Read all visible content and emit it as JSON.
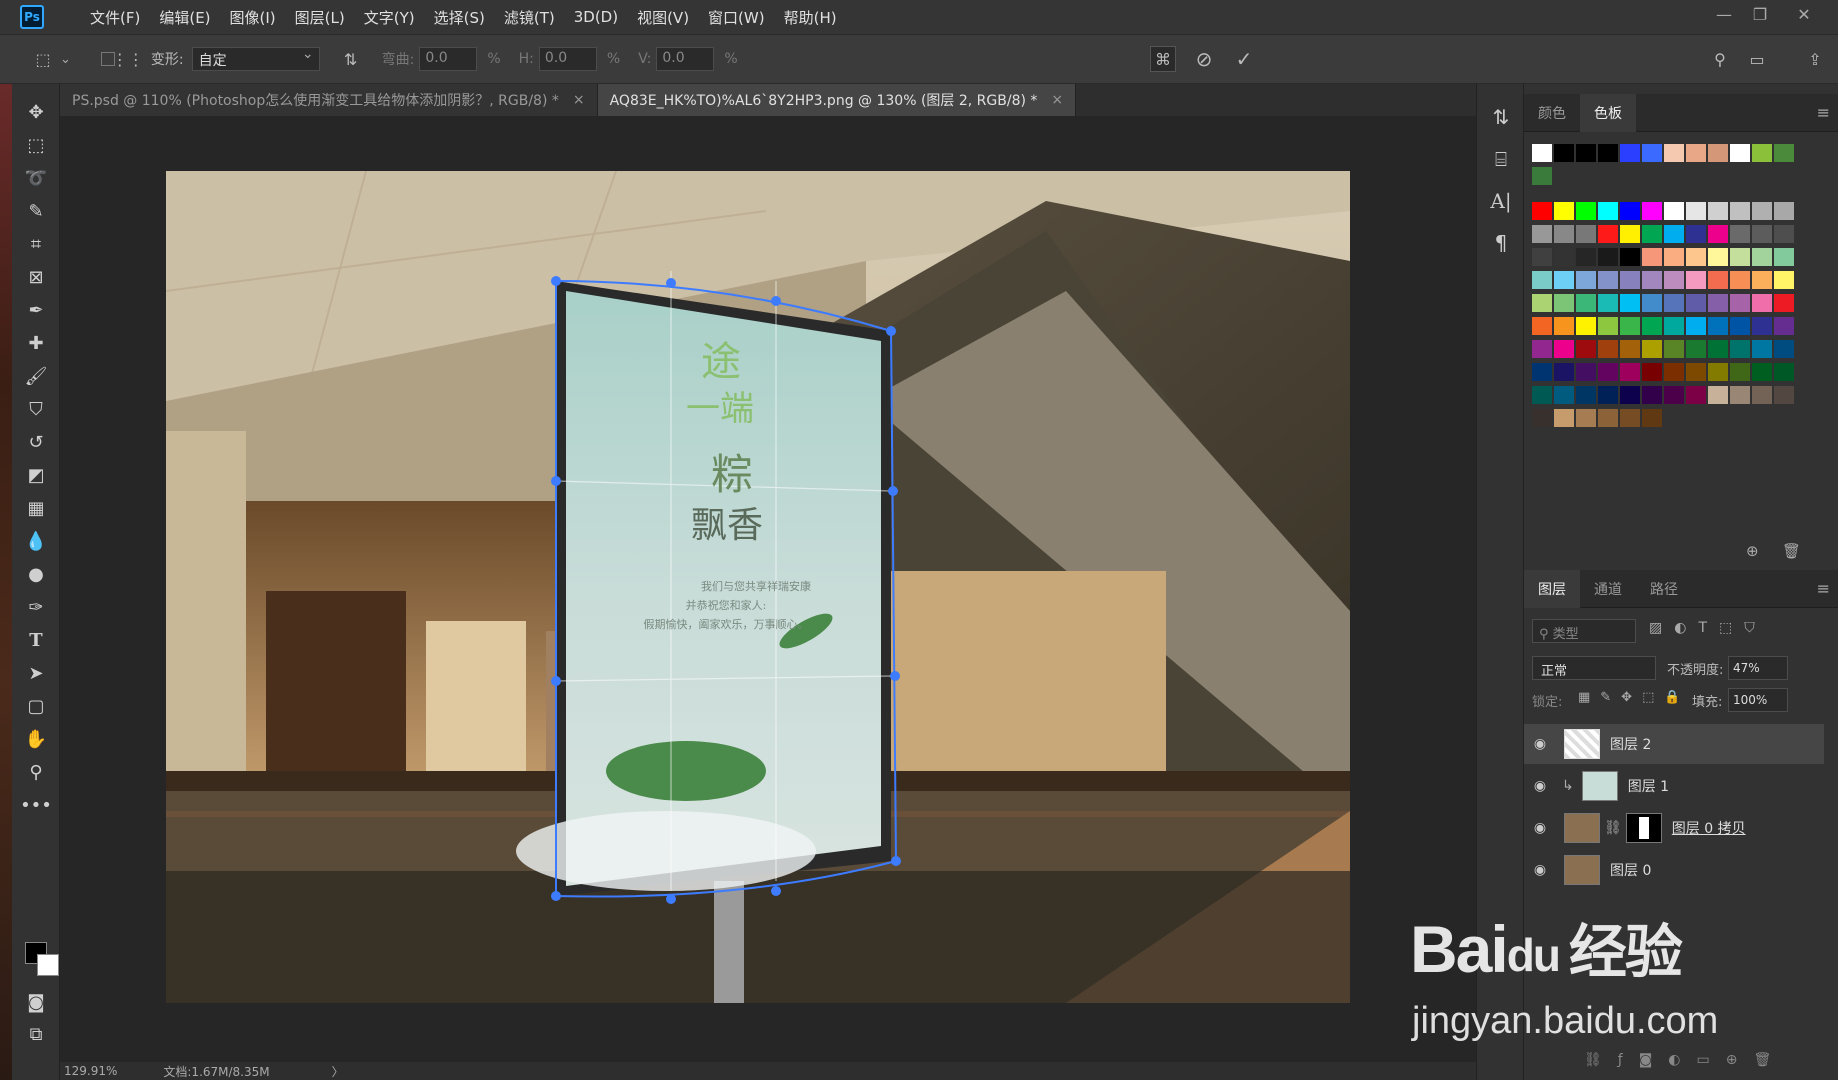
{
  "app": {
    "logo": "Ps"
  },
  "menu": [
    "文件(F)",
    "编辑(E)",
    "图像(I)",
    "图层(L)",
    "文字(Y)",
    "选择(S)",
    "滤镜(T)",
    "3D(D)",
    "视图(V)",
    "窗口(W)",
    "帮助(H)"
  ],
  "window_controls": {
    "minimize": "—",
    "restore": "❐",
    "close": "✕"
  },
  "options": {
    "transform_label": "变形:",
    "transform_value": "自定",
    "bend_label": "弯曲:",
    "bend_value": "0.0",
    "h_label": "H:",
    "h_value": "0.0",
    "v_label": "V:",
    "v_value": "0.0",
    "percent": "%"
  },
  "tabs": [
    {
      "label": "PS.psd @ 110% (Photoshop怎么使用渐变工具给物体添加阴影？, RGB/8) *",
      "close": "×"
    },
    {
      "label": "AQ83E_HK%TO)%AL6`8Y2HP3.png @ 130% (图层 2, RGB/8) *",
      "close": "×"
    }
  ],
  "poster": {
    "title1": "途",
    "title2": "一端",
    "title3": "粽",
    "title4": "飘香",
    "line1": "我们与您共享祥瑞安康",
    "line2": "并恭祝您和家人:",
    "line3": "假期愉快，阖家欢乐，万事顺心。"
  },
  "status": {
    "zoom": "129.91%",
    "doc": "文档:1.67M/8.35M",
    "arrow": "〉"
  },
  "color_panel": {
    "tab_color": "颜色",
    "tab_swatches": "色板"
  },
  "swatch_colors": {
    "recent": [
      "#ffffff",
      "#000000",
      "#000000",
      "#000000",
      "#2a3fff",
      "#3a6aff",
      "#f5c8b0",
      "#e8a888",
      "#d49878",
      "#ffffff",
      "#8ac03a",
      "#4a8a3a",
      "#3a7a3a"
    ],
    "grid": [
      "#ff0000",
      "#ffff00",
      "#00ff00",
      "#00ffff",
      "#0000ff",
      "#ff00ff",
      "#ffffff",
      "#e6e6e6",
      "#d0d0d0",
      "#c0c0c0",
      "#b0b0b0",
      "#a8a8a8",
      "#989898",
      "#888888",
      "#787878",
      "#ff1a1a",
      "#ffef00",
      "#00a651",
      "#00aeef",
      "#2e3192",
      "#ec008c",
      "#6a6a6a",
      "#5c5c5c",
      "#4e4e4e",
      "#404040",
      "#333333",
      "#262626",
      "#1a1a1a",
      "#000000",
      "#f7977a",
      "#fbad82",
      "#fdc68c",
      "#fff799",
      "#c4df9b",
      "#a3d39c",
      "#82ca9c",
      "#7accc8",
      "#6dcff6",
      "#7da7d9",
      "#8393ca",
      "#8781bd",
      "#a187be",
      "#bc8cbf",
      "#f49ac1",
      "#f26c4f",
      "#f68e55",
      "#fbaf5a",
      "#fff467",
      "#acd372",
      "#7cc576",
      "#3bb878",
      "#1abbb4",
      "#00bff3",
      "#438ccb",
      "#5574b9",
      "#605ca8",
      "#855fa8",
      "#a763a8",
      "#f06ea9",
      "#ed1c24",
      "#f26522",
      "#f7941d",
      "#fff200",
      "#8dc63f",
      "#39b54a",
      "#00a651",
      "#00a99d",
      "#00aeef",
      "#0072bc",
      "#0054a6",
      "#2e3192",
      "#662d91",
      "#92278f",
      "#ec008c",
      "#9e0b0f",
      "#a0410d",
      "#a36209",
      "#aba000",
      "#598527",
      "#1a7b30",
      "#007236",
      "#00746b",
      "#0076a3",
      "#004b80",
      "#003471",
      "#1b1464",
      "#440e62",
      "#630460",
      "#9e005d",
      "#790000",
      "#7b2e00",
      "#7d4900",
      "#827b00",
      "#406618",
      "#005e20",
      "#005826",
      "#005952",
      "#005b7f",
      "#003663",
      "#002157",
      "#0d004c",
      "#32004b",
      "#4b0049",
      "#7b0046",
      "#c7b299",
      "#998675",
      "#736357",
      "#534741",
      "#37302d",
      "#c69c6d",
      "#a67c52",
      "#8c6239",
      "#754c24",
      "#603913"
    ]
  },
  "layers_panel": {
    "tabs": [
      "图层",
      "通道",
      "路径"
    ],
    "search_placeholder": "类型",
    "blend_mode": "正常",
    "opacity_label": "不透明度:",
    "opacity_value": "47%",
    "lock_label": "锁定:",
    "fill_label": "填充:",
    "fill_value": "100%",
    "layers": [
      {
        "name": "图层 2",
        "selected": true
      },
      {
        "name": "图层 1",
        "selected": false
      },
      {
        "name": "图层 0 拷贝",
        "selected": false
      },
      {
        "name": "图层 0",
        "selected": false
      }
    ]
  },
  "watermark": {
    "brand": "Bai",
    "paw": "du",
    "cn": "经验",
    "url": "jingyan.baidu.com"
  }
}
